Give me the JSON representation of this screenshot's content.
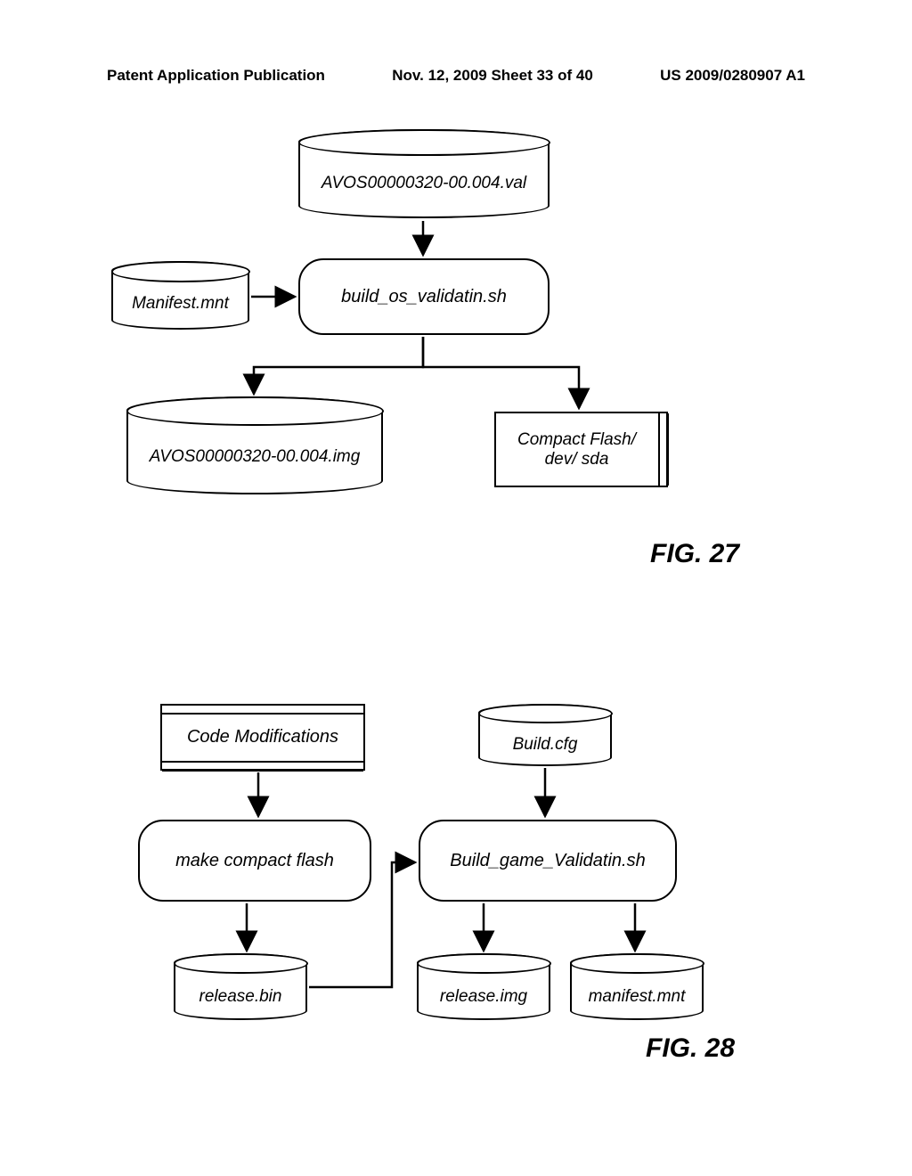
{
  "header": {
    "left": "Patent Application Publication",
    "mid": "Nov. 12, 2009  Sheet 33 of 40",
    "right": "US 2009/0280907 A1"
  },
  "fig27": {
    "label": "FIG. 27",
    "top_cyl": "AVOS00000320-00.004.val",
    "left_cyl": "Manifest.mnt",
    "proc": "build_os_validatin.sh",
    "out_cyl": "AVOS00000320-00.004.img",
    "out_card_l1": "Compact Flash/",
    "out_card_l2": "dev/ sda"
  },
  "fig28": {
    "label": "FIG. 28",
    "code_mods": "Code Modifications",
    "build_cfg": "Build.cfg",
    "make_cf": "make compact flash",
    "build_game": "Build_game_Validatin.sh",
    "release_bin": "release.bin",
    "release_img": "release.img",
    "manifest": "manifest.mnt"
  }
}
